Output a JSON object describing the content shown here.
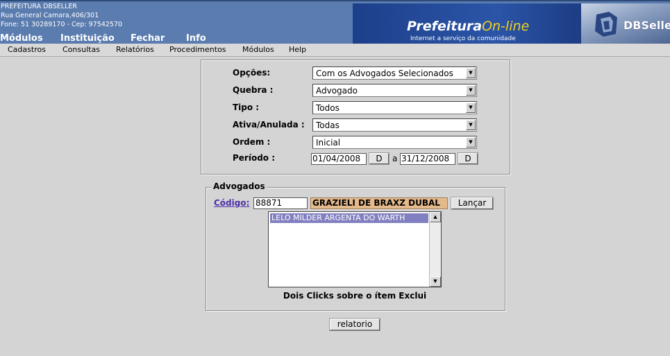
{
  "header": {
    "org_name": "PREFEITURA DBSELLER",
    "address": "Rua General Camara,406/301",
    "phone_line": "Fone: 51 30289170  -  Cep: 97542570",
    "top_menu": [
      "Módulos",
      "Instituição",
      "Fechar",
      "Info"
    ],
    "logo_main": "Prefeitura",
    "logo_highlight": "On-line",
    "logo_tagline": "Internet a serviço da comunidade",
    "brand": "DBSeller"
  },
  "menubar": [
    "Cadastros",
    "Consultas",
    "Relatórios",
    "Procedimentos",
    "Módulos",
    "Help"
  ],
  "filters": {
    "opcoes": {
      "label": "Opções:",
      "value": "Com os Advogados Selecionados"
    },
    "quebra": {
      "label": "Quebra :",
      "value": "Advogado"
    },
    "tipo": {
      "label": "Tipo :",
      "value": "Todos"
    },
    "ativa": {
      "label": "Ativa/Anulada :",
      "value": "Todas"
    },
    "ordem": {
      "label": "Ordem :",
      "value": "Inicial"
    },
    "periodo": {
      "label": "Período :",
      "start": "01/04/2008",
      "end": "31/12/2008",
      "separator": "a",
      "date_button": "D"
    }
  },
  "advogados": {
    "legend": "Advogados",
    "codigo_label": "Código:",
    "codigo_value": "88871",
    "name_value": "GRAZIELI DE BRAXZ DUBAL",
    "lancar_button": "Lançar",
    "selected_items": [
      "LELO MILDER ARGENTA DO WARTH"
    ],
    "hint": "Dois Clicks sobre o ítem Exclui"
  },
  "report_button": "relatorio",
  "colors": {
    "header_bg": "#5a7caf",
    "banner_bg": "#2b55a8",
    "logo_highlight": "#f5d21e",
    "page_bg": "#d4d4d4",
    "link": "#4b2fa8",
    "selection": "#8080c0",
    "name_field_bg": "#e4b98b"
  }
}
